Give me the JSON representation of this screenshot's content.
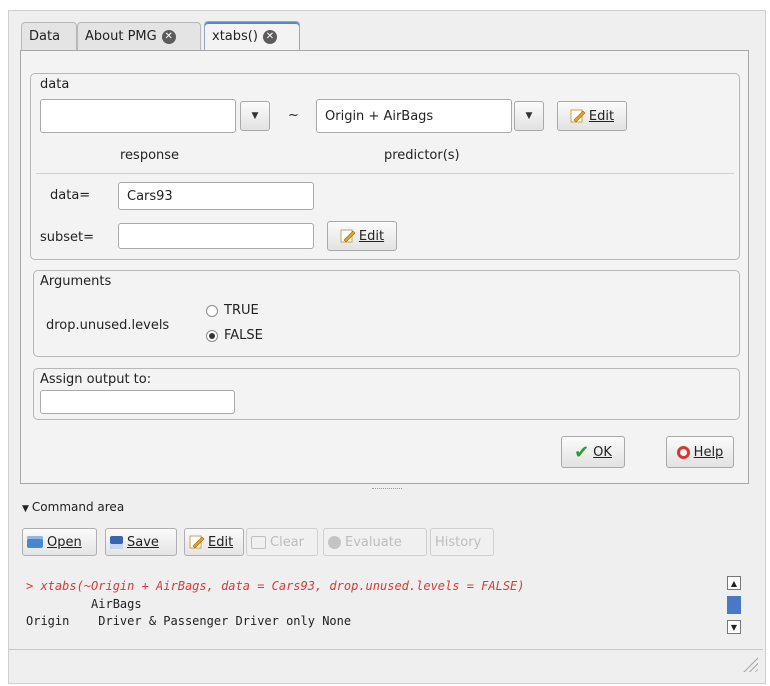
{
  "tabs": [
    {
      "label": "Data",
      "closable": false
    },
    {
      "label": "About PMG",
      "closable": true
    },
    {
      "label": "xtabs()",
      "closable": true
    }
  ],
  "data_frame": {
    "label": "data",
    "response_value": "",
    "tilde": "~",
    "predictor_value": "Origin + AirBags",
    "edit_label": "Edit",
    "response_caption": "response",
    "predictor_caption": "predictor(s)",
    "data_label": "data=",
    "data_value": "Cars93",
    "subset_label": "subset=",
    "subset_value": "",
    "subset_edit_label": "Edit"
  },
  "arguments": {
    "label": "Arguments",
    "param": "drop.unused.levels",
    "options": [
      "TRUE",
      "FALSE"
    ],
    "selected": "FALSE"
  },
  "assign": {
    "label": "Assign output to:",
    "value": ""
  },
  "buttons": {
    "ok": "OK",
    "help": "Help"
  },
  "command_area": {
    "label": "Command area",
    "toolbar": {
      "open": "Open",
      "save": "Save",
      "edit": "Edit",
      "clear": "Clear",
      "evaluate": "Evaluate",
      "history": "History"
    },
    "output": {
      "command": "> xtabs(~Origin + AirBags, data = Cars93, drop.unused.levels = FALSE)",
      "line2": "         AirBags",
      "line3": "Origin    Driver & Passenger Driver only None"
    }
  },
  "colors": {
    "command_red": "#d83a3a",
    "ok_green": "#2e9b2e",
    "tab_accent": "#5a84c8",
    "scroll_thumb": "#4a78c8"
  }
}
